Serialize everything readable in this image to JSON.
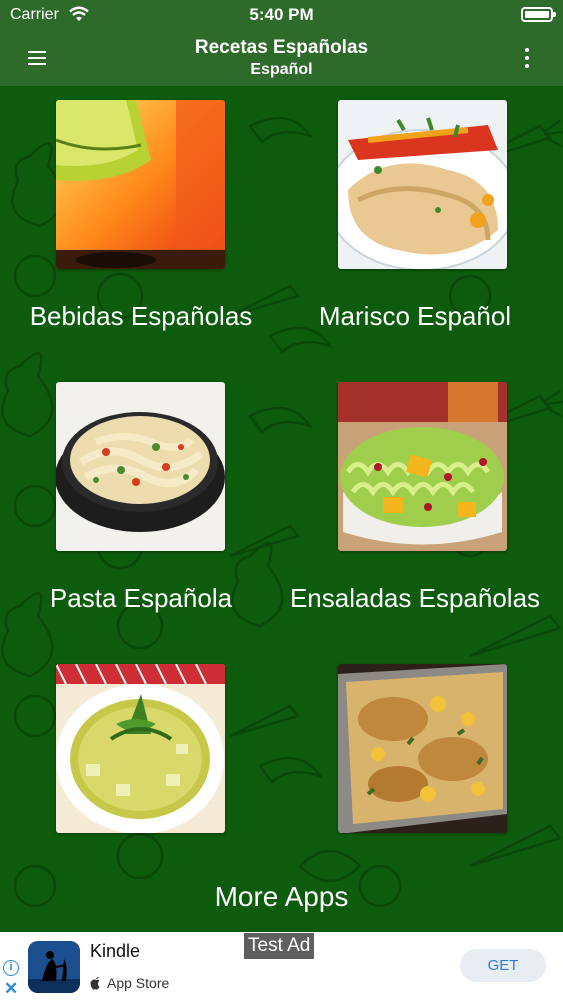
{
  "status_bar": {
    "carrier": "Carrier",
    "time": "5:40 PM"
  },
  "app_bar": {
    "title": "Recetas Españolas",
    "subtitle": "Español"
  },
  "colors": {
    "app_bar": "#2e6b2b",
    "background": "#0d5c0d",
    "get_button_text": "#2a7ad8"
  },
  "categories": [
    {
      "label": "Bebidas Españolas",
      "image": "orange-drink-photo"
    },
    {
      "label": "Marisco Español",
      "image": "fish-fillet-photo"
    },
    {
      "label": "Pasta Española",
      "image": "pasta-bowl-photo"
    },
    {
      "label": "Ensaladas Españolas",
      "image": "salad-bowl-photo"
    },
    {
      "label": "",
      "image": "soup-bowl-photo"
    },
    {
      "label": "",
      "image": "chicken-casserole-photo"
    }
  ],
  "more_apps": "More Apps",
  "ad": {
    "app_name": "Kindle",
    "store": "App Store",
    "badge": "Test Ad",
    "cta": "GET",
    "info": "i",
    "close": "✕"
  }
}
